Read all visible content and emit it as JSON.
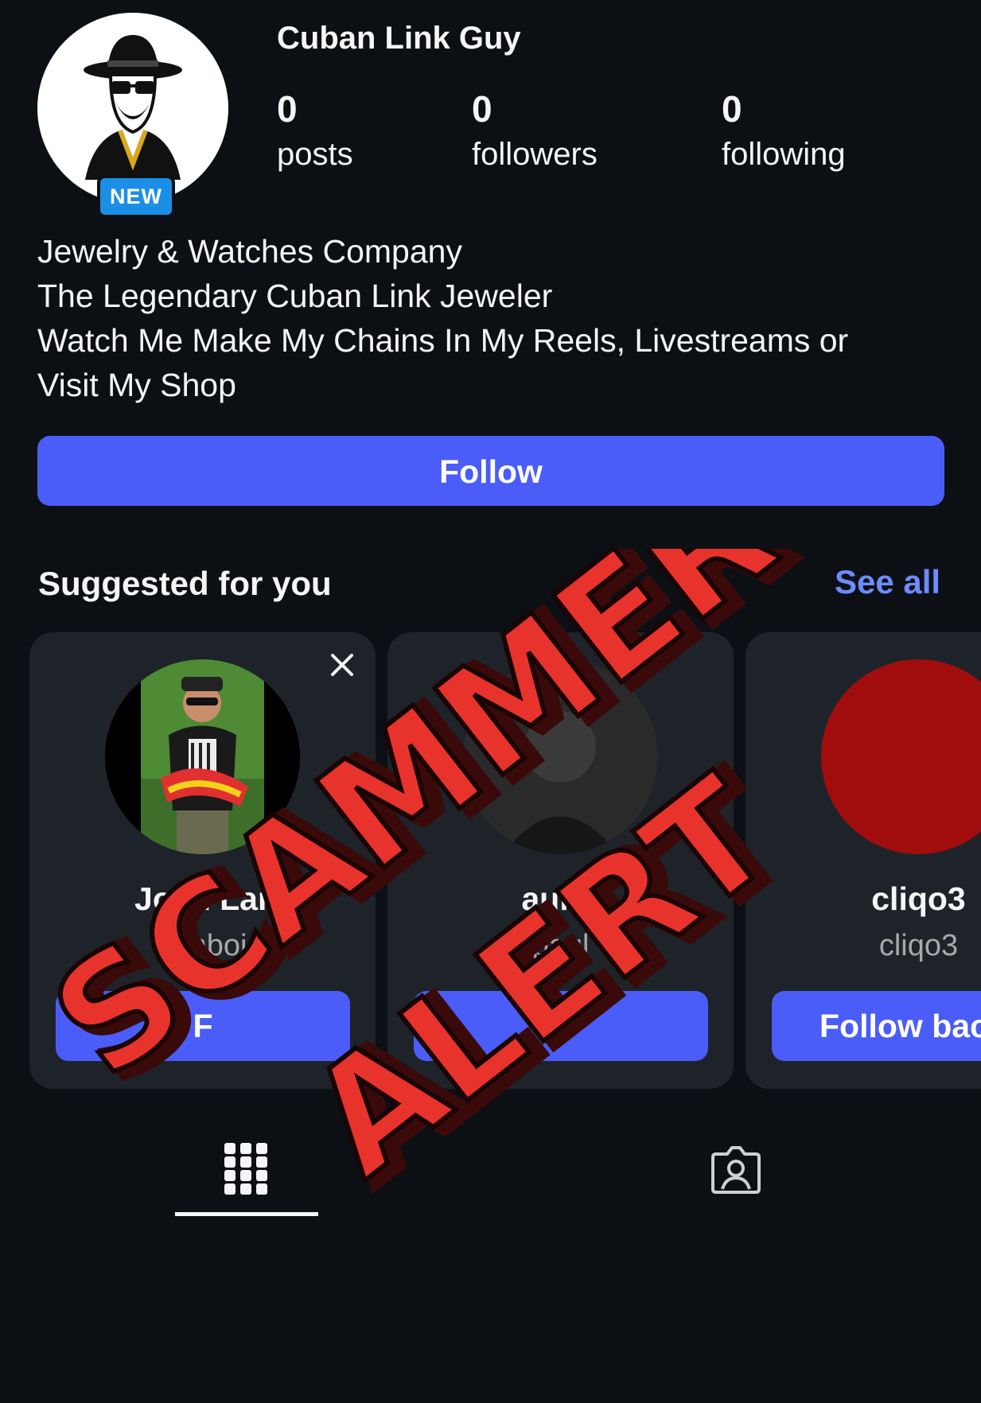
{
  "profile": {
    "username": "Cuban Link Guy",
    "new_badge": "NEW",
    "stats": [
      {
        "count": "0",
        "label": "posts"
      },
      {
        "count": "0",
        "label": "followers"
      },
      {
        "count": "0",
        "label": "following"
      }
    ],
    "bio": [
      "Jewelry & Watches Company",
      "The Legendary Cuban Link Jeweler",
      "Watch Me Make My Chains In My Reels, Livestreams or",
      "Visit My Shop"
    ],
    "follow_label": "Follow"
  },
  "suggested": {
    "title": "Suggested for you",
    "see_all": "See all",
    "cards": [
      {
        "name": "Josh Lar",
        "handle": "lamboj",
        "button": "F"
      },
      {
        "name": "aul S",
        "handle": "paul",
        "button": "F"
      },
      {
        "name": "cliqo3",
        "handle": "cliqo3",
        "button": "Follow bac"
      }
    ]
  },
  "tabs": {
    "grid": "grid-icon",
    "tagged": "tagged-person-icon"
  },
  "overlay": {
    "line1": "SCAMMER",
    "line2": "ALERT",
    "color": "#e8332c"
  }
}
